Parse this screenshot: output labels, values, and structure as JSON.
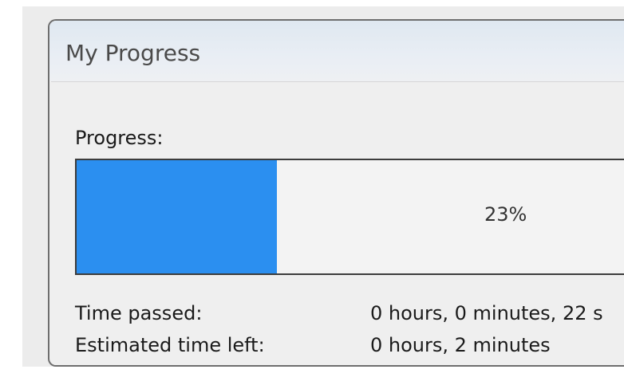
{
  "window": {
    "title": "My Progress"
  },
  "progress": {
    "label": "Progress:",
    "percent": 23,
    "percent_text": "23%",
    "fill_color": "#2b8ff0"
  },
  "info": {
    "time_passed_label": "Time passed:",
    "time_passed_value": "0 hours, 0 minutes, 22 s",
    "time_left_label": "Estimated time left:",
    "time_left_value": "0 hours, 2 minutes"
  }
}
